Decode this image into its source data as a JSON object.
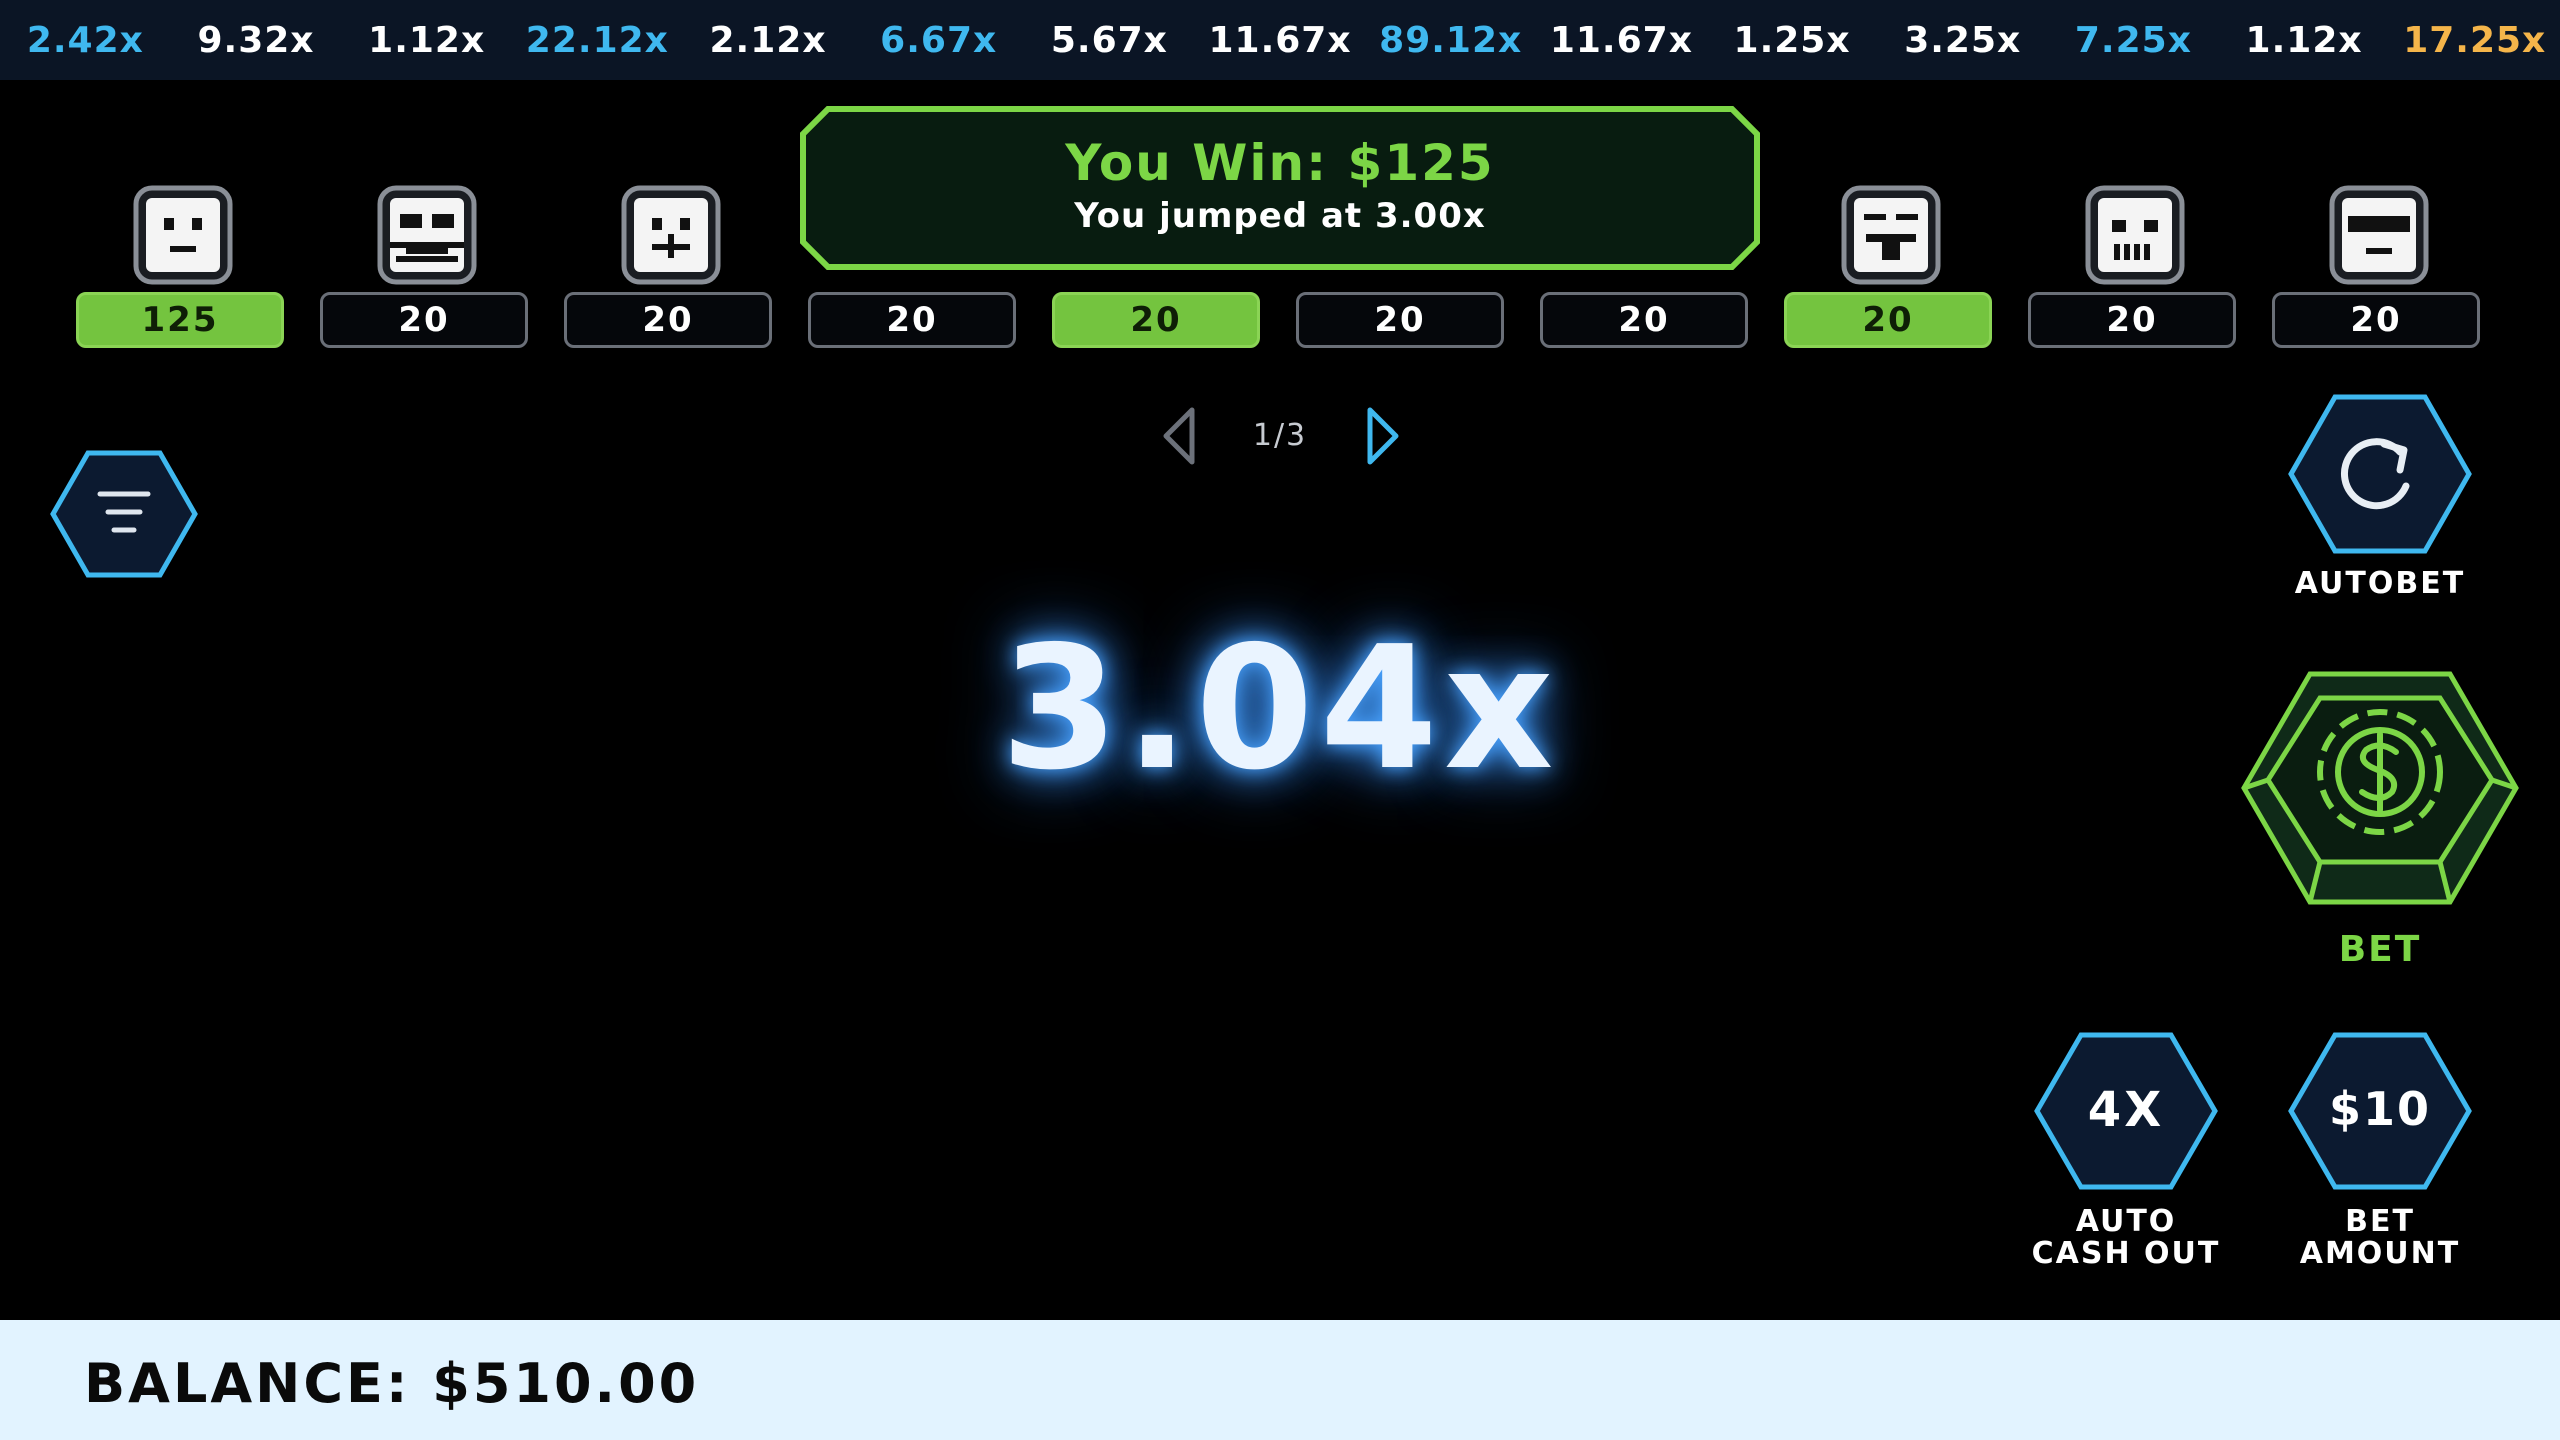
{
  "history": [
    {
      "value": "2.42x",
      "color": "blue"
    },
    {
      "value": "9.32x",
      "color": "white"
    },
    {
      "value": "1.12x",
      "color": "white"
    },
    {
      "value": "22.12x",
      "color": "blue"
    },
    {
      "value": "2.12x",
      "color": "white"
    },
    {
      "value": "6.67x",
      "color": "blue"
    },
    {
      "value": "5.67x",
      "color": "white"
    },
    {
      "value": "11.67x",
      "color": "white"
    },
    {
      "value": "89.12x",
      "color": "blue"
    },
    {
      "value": "11.67x",
      "color": "white"
    },
    {
      "value": "1.25x",
      "color": "white"
    },
    {
      "value": "3.25x",
      "color": "white"
    },
    {
      "value": "7.25x",
      "color": "blue"
    },
    {
      "value": "1.12x",
      "color": "white"
    },
    {
      "value": "17.25x",
      "color": "gold"
    }
  ],
  "players": [
    {
      "bet": "125",
      "won": true,
      "face": "neutral"
    },
    {
      "bet": "20",
      "won": false,
      "face": "grin"
    },
    {
      "bet": "20",
      "won": false,
      "face": "smirk"
    },
    {
      "bet": "20",
      "won": false,
      "face": "hidden"
    },
    {
      "bet": "20",
      "won": true,
      "face": "hidden"
    },
    {
      "bet": "20",
      "won": false,
      "face": "hidden"
    },
    {
      "bet": "20",
      "won": false,
      "face": "hidden"
    },
    {
      "bet": "20",
      "won": true,
      "face": "tongue"
    },
    {
      "bet": "20",
      "won": false,
      "face": "skull"
    },
    {
      "bet": "20",
      "won": false,
      "face": "visor"
    }
  ],
  "win_banner": {
    "title": "You Win: $125",
    "subtitle": "You jumped at 3.00x"
  },
  "pager": {
    "indicator": "1/3"
  },
  "multiplier": "3.04x",
  "buttons": {
    "menu_icon": "menu-lines-icon",
    "autobet_label": "AUTOBET",
    "bet_label": "BET",
    "auto_cashout_value": "4X",
    "auto_cashout_label_1": "AUTO",
    "auto_cashout_label_2": "CASH OUT",
    "bet_amount_value": "$10",
    "bet_amount_label_1": "BET",
    "bet_amount_label_2": "AMOUNT"
  },
  "balance": "BALANCE: $510.00",
  "colors": {
    "accent_blue": "#3fb8ef",
    "accent_green": "#7cd646",
    "gold": "#f5b54a",
    "grid": "#b8741c",
    "panel_navy": "#0c1a30",
    "balance_bg": "#e2f3ff"
  }
}
